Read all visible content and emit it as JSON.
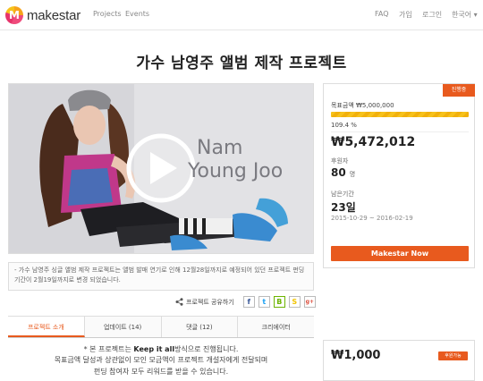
{
  "header": {
    "logo_text": "makestar",
    "nav": {
      "projects": "Projects",
      "events": "Events"
    },
    "right_nav": {
      "faq": "FAQ",
      "join": "가입",
      "login": "로그인",
      "lang": "한국어 ▾"
    }
  },
  "project": {
    "title": "가수 남영주 앨범 제작 프로젝트",
    "video_overlay_text": [
      "Nam",
      "Young Joo"
    ],
    "notice": "- 가수 남영주 싱글 앨범 제작 프로젝트는 앨범 발매 연기로 인해 12월28일까지로 예정되어 있던 프로젝트 펀딩 기간이 2월19일까지로 변경 되었습니다.",
    "share_label": "프로젝트 공유하기",
    "share_buttons": [
      "f",
      "t",
      "B",
      "S",
      "g+"
    ]
  },
  "tabs": [
    {
      "label": "프로젝트 소개",
      "active": true
    },
    {
      "label": "업데이트 (14)",
      "active": false
    },
    {
      "label": "댓글 (12)",
      "active": false
    },
    {
      "label": "크리에이터",
      "active": false
    }
  ],
  "description": {
    "line1_prefix": "* 본 프로젝트는 ",
    "line1_bold": "Keep it all",
    "line1_suffix": "방식으로 진행됩니다.",
    "line2": "목표금액 달성과 상관없이 모인 모금액이 프로젝트 개설자에게 전달되며",
    "line3": "펀딩 참여자 모두 리워드를 받을 수 있습니다."
  },
  "funding": {
    "status_badge": "진행중",
    "goal_label": "목표금액 ₩5,000,000",
    "progress_fraction": 1.0,
    "percent": "109.4 %",
    "amount": "₩5,472,012",
    "backers_label": "후원자",
    "backers": "80",
    "backers_unit": "명",
    "remaining_label": "남은기간",
    "remaining": "23일",
    "dates": "2015-10-29 ~ 2016-02-19",
    "cta": "Makestar Now"
  },
  "reward": {
    "amount": "₩1,000",
    "badge": "후원가능"
  },
  "colors": {
    "accent": "#e85a1e",
    "progress": "#f6c21a"
  }
}
